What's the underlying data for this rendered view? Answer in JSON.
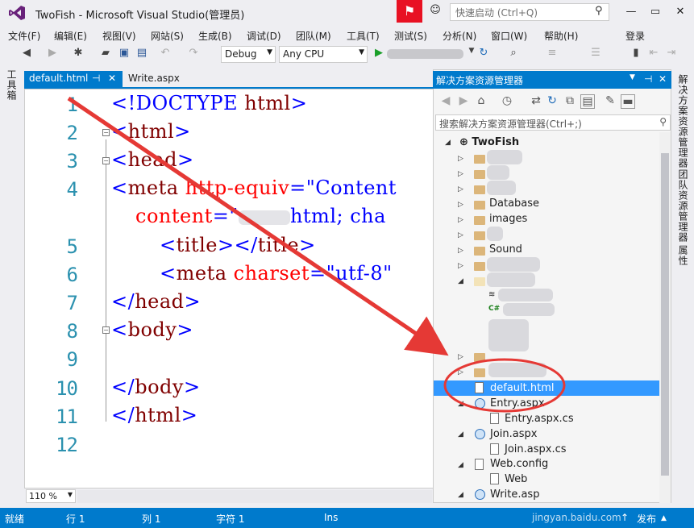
{
  "window": {
    "title": "TwoFish - Microsoft Visual Studio(管理员)",
    "quick_launch_placeholder": "快速启动 (Ctrl+Q)",
    "minimize": "—",
    "restore": "▭",
    "close": "✕"
  },
  "menu": [
    "文件(F)",
    "编辑(E)",
    "视图(V)",
    "网站(S)",
    "生成(B)",
    "调试(D)",
    "团队(M)",
    "工具(T)",
    "测试(S)",
    "分析(N)",
    "窗口(W)",
    "帮助(H)"
  ],
  "signin": "登录",
  "toolbar": {
    "config": "Debug",
    "platform": "Any CPU"
  },
  "toolbox_tab": "工具箱",
  "tabs": [
    {
      "label": "default.html",
      "pin": "⊣",
      "close": "✕"
    },
    {
      "label": "Write.aspx"
    }
  ],
  "editor": {
    "lines": [
      "1",
      "2",
      "3",
      "4",
      "5",
      "6",
      "7",
      "8",
      "9",
      "10",
      "11",
      "12"
    ],
    "zoom": "110 %"
  },
  "code": {
    "l1a": "<!DOCTYPE ",
    "l1b": "html",
    "l1c": ">",
    "l2a": "<",
    "l2b": "html",
    "l2c": ">",
    "l3a": "<",
    "l3b": "head",
    "l3c": ">",
    "l4a": "<",
    "l4b": "meta ",
    "l4c": "http-equiv",
    "l4d": "=\"Content",
    "l4e": "content",
    "l4f": "=\"",
    "l4g": "html; cha",
    "l5a": "<",
    "l5b": "title",
    "l5c": "></",
    "l5d": "title",
    "l5e": ">",
    "l6a": "<",
    "l6b": "meta ",
    "l6c": "charset",
    "l6d": "=\"utf-8\"",
    "l7a": "</",
    "l7b": "head",
    "l7c": ">",
    "l8a": "<",
    "l8b": "body",
    "l8c": ">",
    "l10a": "</",
    "l10b": "body",
    "l10c": ">",
    "l11a": "</",
    "l11b": "html",
    "l11c": ">"
  },
  "solution_explorer": {
    "title": "解决方案资源管理器",
    "search_placeholder": "搜索解决方案资源管理器(Ctrl+;)",
    "items": {
      "root": "TwoFish",
      "database": "Database",
      "images": "images",
      "sound": "Sound",
      "default": "default.html",
      "entry": "Entry.aspx",
      "entry_cs": "Entry.aspx.cs",
      "join": "Join.aspx",
      "join_cs": "Join.aspx.cs",
      "webconfig": "Web.config",
      "web": "Web",
      "write": "Write.asp"
    }
  },
  "right_tabs": [
    "解决方案资源管理器",
    "团队资源管理器",
    "属性"
  ],
  "status": {
    "ready": "就绪",
    "line": "行 1",
    "col": "列 1",
    "char": "字符 1",
    "mode": "Ins",
    "publish": "发布"
  },
  "watermark": "jingyan.baidu.com",
  "colors": {
    "accent": "#007acc",
    "selection": "#3399ff",
    "annotation": "#e53935"
  }
}
